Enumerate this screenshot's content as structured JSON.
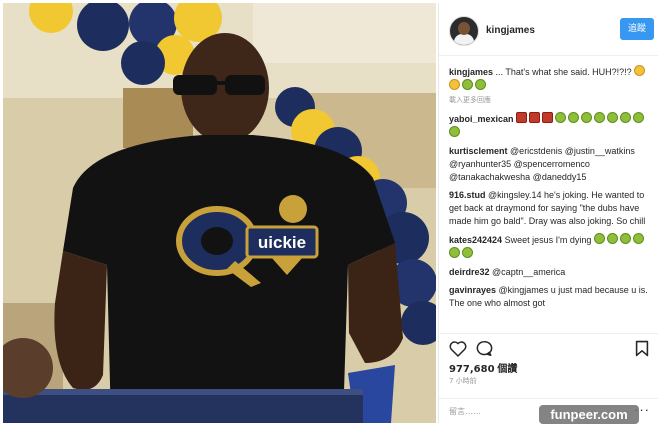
{
  "post": {
    "username": "kingjames",
    "follow_label": "追蹤",
    "likes_count": "977,680",
    "likes_unit": "個讚",
    "time_ago": "7 小時前",
    "add_comment_placeholder": "留言……",
    "more_options": "···"
  },
  "comments": [
    {
      "user": "kingjames",
      "text": "... That's what she said. HUH?!?!?",
      "meta": "載入更多回應"
    },
    {
      "user": "yaboi_mexican",
      "text": ""
    },
    {
      "user": "kurtisclement",
      "text": "@ericstdenis @justin__watkins @ryanhunter35 @spencerromenco @tanakachakwesha @daneddy15"
    },
    {
      "user": "916.stud",
      "text": "@kingsley.14 he's joking. He wanted to get back at draymond for saying \"the dubs have made him go bald\". Dray was also joking. So chill"
    },
    {
      "user": "kates242424",
      "text": "Sweet jesus I'm dying"
    },
    {
      "user": "deirdre32",
      "text": "@captn__america"
    },
    {
      "user": "gavinrayes",
      "text": "@kingjames u just mad because u is. The one who almost got"
    }
  ],
  "photo": {
    "shirt_logo_text": "uickie"
  },
  "watermark": "funpeer.com",
  "icons": [
    "heart-icon",
    "comment-icon",
    "bookmark-icon"
  ],
  "colors": {
    "follow_button": "#3897f0",
    "shirt": "#111111",
    "balloon_yellow": "#f2c832",
    "balloon_navy": "#1d2d5e"
  }
}
